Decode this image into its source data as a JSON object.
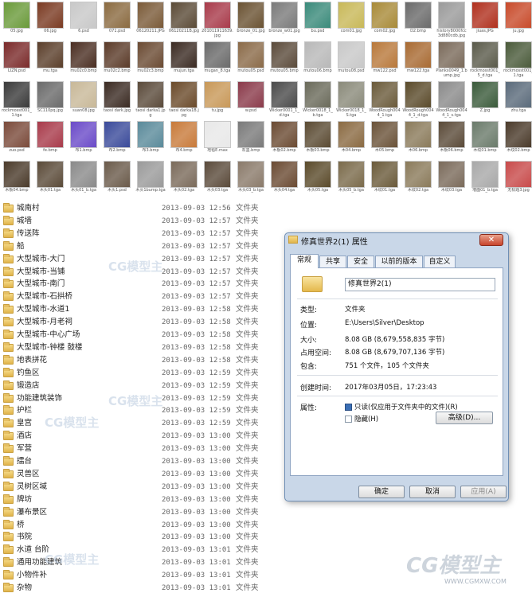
{
  "thumbnails": [
    {
      "label": "05.jpg",
      "c": "#6a9a3a"
    },
    {
      "label": "06.jpg",
      "c": "#7a3a22"
    },
    {
      "label": "6.psd",
      "c": "#c8c8c8"
    },
    {
      "label": "071.psd",
      "c": "#8a6a40"
    },
    {
      "label": "06120211.JPG",
      "c": "#7a5a38"
    },
    {
      "label": "06120211B.jpg",
      "c": "#5a4a36"
    },
    {
      "label": "201011911639.jpg",
      "c": "#a83a4a"
    },
    {
      "label": "bronze_01.jpg",
      "c": "#6a5232"
    },
    {
      "label": "bronze_w01.jpg",
      "c": "#7a7a7a"
    },
    {
      "label": "bu.psd",
      "c": "#3a8a7a"
    },
    {
      "label": "com01.jpg",
      "c": "#c8b858"
    },
    {
      "label": "com02.jpg",
      "c": "#a88a38"
    },
    {
      "label": "D2.bmp",
      "c": "#6a6a6a"
    },
    {
      "label": "history8000fcc3d880cdb.jpg",
      "c": "#9a9a9a"
    },
    {
      "label": "jiuas.JPG",
      "c": "#b0301e"
    },
    {
      "label": "ju.jpg",
      "c": "#c84a2a"
    },
    {
      "label": "LIZN.psd",
      "c": "#7a2a2a"
    },
    {
      "label": "mu.tga",
      "c": "#5a3e2a"
    },
    {
      "label": "mu02c0.bmp",
      "c": "#4a2e22"
    },
    {
      "label": "mu02c2.bmp",
      "c": "#5a3a28"
    },
    {
      "label": "mu02c3.bmp",
      "c": "#6a4a32"
    },
    {
      "label": "mujun.tga",
      "c": "#3a2a22"
    },
    {
      "label": "mugan_8.tga",
      "c": "#6a6a6a"
    },
    {
      "label": "mutou05.psd",
      "c": "#8a6a48"
    },
    {
      "label": "mutou05.bmp",
      "c": "#5a4a3a"
    },
    {
      "label": "mutou06.bmp",
      "c": "#b8b8b8"
    },
    {
      "label": "mutou08.psd",
      "c": "#c8c8c8"
    },
    {
      "label": "mw122.psd",
      "c": "#b8783a"
    },
    {
      "label": "mw122.tga",
      "c": "#a86a32"
    },
    {
      "label": "Planks0049_1.bump.jpg",
      "c": "#7a6a5a"
    },
    {
      "label": "rockmosst001_5_d.tga",
      "c": "#5a5a4a"
    },
    {
      "label": "rockmosst001_1.tga",
      "c": "#4a5a3a"
    },
    {
      "label": "rockmosst001_1.tga",
      "c": "#3a3a3a"
    },
    {
      "label": "SC110pq.jpg",
      "c": "#6a6a6a"
    },
    {
      "label": "suan08.jpg",
      "c": "#c8b898"
    },
    {
      "label": "taosi dark.jpg",
      "c": "#3a2a22"
    },
    {
      "label": "taosi darka1.jpg",
      "c": "#5a4a3a"
    },
    {
      "label": "taosi darka1B.jpg",
      "c": "#6a4a2a"
    },
    {
      "label": "tu.jpg",
      "c": "#c89858"
    },
    {
      "label": "w.psd",
      "c": "#8a3a4a"
    },
    {
      "label": "Wicker0001_1_d.tga",
      "c": "#4a4a4a"
    },
    {
      "label": "Wicker0018_1_b.tga",
      "c": "#6a6a5a"
    },
    {
      "label": "Wicker0018_1_S.tga",
      "c": "#8a8a7a"
    },
    {
      "label": "WoodRough0044_1.tga",
      "c": "#6a5a3a"
    },
    {
      "label": "WoodRough0044_1_d.tga",
      "c": "#5a4a2a"
    },
    {
      "label": "WoodRough0044_1_s.tga",
      "c": "#8a8a8a"
    },
    {
      "label": "Z.jpg",
      "c": "#3a5a3a"
    },
    {
      "label": "zhu.tga",
      "c": "#5a6a7a"
    },
    {
      "label": "zuo.psd",
      "c": "#7a4a3a"
    },
    {
      "label": "fe.bmp",
      "c": "#a83a4a"
    },
    {
      "label": "布1.bmp",
      "c": "#6a4ac8"
    },
    {
      "label": "布2.bmp",
      "c": "#3a4a9a"
    },
    {
      "label": "布3.bmp",
      "c": "#5a8a9a"
    },
    {
      "label": "布4.bmp",
      "c": "#c87a3a"
    },
    {
      "label": "地毯E.max",
      "c": "#e8e8e8"
    },
    {
      "label": "石墨.bmp",
      "c": "#7a7a7a"
    },
    {
      "label": "木板02.bmp",
      "c": "#6a4a32"
    },
    {
      "label": "木板03.bmp",
      "c": "#5a4a32"
    },
    {
      "label": "木04.bmp",
      "c": "#8a6a42"
    },
    {
      "label": "木05.bmp",
      "c": "#6a5238"
    },
    {
      "label": "木06.bmp",
      "c": "#8a7a5a"
    },
    {
      "label": "木板06.bmp",
      "c": "#5a4a38"
    },
    {
      "label": "木纹01.bmp",
      "c": "#6a7a6a"
    },
    {
      "label": "木纹02.bmp",
      "c": "#4a3a2a"
    },
    {
      "label": "木板04.bmp",
      "c": "#4a3a2a"
    },
    {
      "label": "木头01.tga",
      "c": "#5a4a38"
    },
    {
      "label": "木头01_b.tga",
      "c": "#8a8a8a"
    },
    {
      "label": "木头1.psd",
      "c": "#6a5a4a"
    },
    {
      "label": "木头1bump.tga",
      "c": "#9a9a9a"
    },
    {
      "label": "木头02.tga",
      "c": "#7a6a5a"
    },
    {
      "label": "木头03.tga",
      "c": "#5a4a3a"
    },
    {
      "label": "木头03_b.tga",
      "c": "#8a7a6a"
    },
    {
      "label": "木头04.tga",
      "c": "#6a4a32"
    },
    {
      "label": "木头05.tga",
      "c": "#5a4a2a"
    },
    {
      "label": "木头05_b.tga",
      "c": "#7a6a4a"
    },
    {
      "label": "木纹01.tga",
      "c": "#6a5a3a"
    },
    {
      "label": "木纹02.tga",
      "c": "#8a7a5a"
    },
    {
      "label": "木纹03.tga",
      "c": "#7a6a5a"
    },
    {
      "label": "墙面01_b.tga",
      "c": "#a8a8a8"
    },
    {
      "label": "无标题3.jpg",
      "c": "#c84a4a"
    }
  ],
  "rows": [
    {
      "name": "城南村",
      "date": "2013-09-03 12:56",
      "type": "文件夹"
    },
    {
      "name": "城墙",
      "date": "2013-09-03 12:57",
      "type": "文件夹"
    },
    {
      "name": "传送阵",
      "date": "2013-09-03 12:57",
      "type": "文件夹"
    },
    {
      "name": "船",
      "date": "2013-09-03 12:57",
      "type": "文件夹"
    },
    {
      "name": "大型城市-大门",
      "date": "2013-09-03 12:57",
      "type": "文件夹"
    },
    {
      "name": "大型城市-当铺",
      "date": "2013-09-03 12:57",
      "type": "文件夹"
    },
    {
      "name": "大型城市-南门",
      "date": "2013-09-03 12:57",
      "type": "文件夹"
    },
    {
      "name": "大型城市-石拱桥",
      "date": "2013-09-03 12:57",
      "type": "文件夹"
    },
    {
      "name": "大型城市-水道1",
      "date": "2013-09-03 12:58",
      "type": "文件夹"
    },
    {
      "name": "大型城市-月老祠",
      "date": "2013-09-03 12:58",
      "type": "文件夹"
    },
    {
      "name": "大型城市-中心广场",
      "date": "2013-09-03 12:58",
      "type": "文件夹"
    },
    {
      "name": "大型城市-钟楼 鼓楼",
      "date": "2013-09-03 12:58",
      "type": "文件夹"
    },
    {
      "name": "地表拼花",
      "date": "2013-09-03 12:58",
      "type": "文件夹"
    },
    {
      "name": "钓鱼区",
      "date": "2013-09-03 12:59",
      "type": "文件夹"
    },
    {
      "name": "锻造店",
      "date": "2013-09-03 12:59",
      "type": "文件夹"
    },
    {
      "name": "功能建筑装饰",
      "date": "2013-09-03 12:59",
      "type": "文件夹"
    },
    {
      "name": "护栏",
      "date": "2013-09-03 12:59",
      "type": "文件夹"
    },
    {
      "name": "皇宫",
      "date": "2013-09-03 12:59",
      "type": "文件夹"
    },
    {
      "name": "酒店",
      "date": "2013-09-03 13:00",
      "type": "文件夹"
    },
    {
      "name": "军营",
      "date": "2013-09-03 13:00",
      "type": "文件夹"
    },
    {
      "name": "擂台",
      "date": "2013-09-03 13:00",
      "type": "文件夹"
    },
    {
      "name": "灵兽区",
      "date": "2013-09-03 13:00",
      "type": "文件夹"
    },
    {
      "name": "灵树区域",
      "date": "2013-09-03 13:00",
      "type": "文件夹"
    },
    {
      "name": "牌坊",
      "date": "2013-09-03 13:00",
      "type": "文件夹"
    },
    {
      "name": "瀑布景区",
      "date": "2013-09-03 13:00",
      "type": "文件夹"
    },
    {
      "name": "桥",
      "date": "2013-09-03 13:00",
      "type": "文件夹"
    },
    {
      "name": "书院",
      "date": "2013-09-03 13:00",
      "type": "文件夹"
    },
    {
      "name": "水道 台阶",
      "date": "2013-09-03 13:01",
      "type": "文件夹"
    },
    {
      "name": "通用功能建筑",
      "date": "2013-09-03 13:01",
      "type": "文件夹"
    },
    {
      "name": "小物件补",
      "date": "2013-09-03 13:01",
      "type": "文件夹"
    },
    {
      "name": "杂物",
      "date": "2013-09-03 13:01",
      "type": "文件夹"
    }
  ],
  "dialog": {
    "title": "修真世界2(1) 属性",
    "close": "✕",
    "tabs": [
      "常规",
      "共享",
      "安全",
      "以前的版本",
      "自定义"
    ],
    "name_value": "修真世界2(1)",
    "type_label": "类型:",
    "type_value": "文件夹",
    "location_label": "位置:",
    "location_value": "E:\\Users\\Silver\\Desktop",
    "size_label": "大小:",
    "size_value": "8.08 GB (8,679,558,835 字节)",
    "disk_label": "占用空间:",
    "disk_value": "8.08 GB (8,679,707,136 字节)",
    "contains_label": "包含:",
    "contains_value": "751 个文件，105 个文件夹",
    "created_label": "创建时间:",
    "created_value": "2017年03月05日，17:23:43",
    "attr_label": "属性:",
    "readonly_label": "只读(仅应用于文件夹中的文件)(R)",
    "hidden_label": "隐藏(H)",
    "advanced_button": "高级(D)...",
    "ok_button": "确定",
    "cancel_button": "取消",
    "apply_button": "应用(A)"
  },
  "watermark": "CG模型主",
  "watermark_url": "WWW.CGMXW.COM"
}
